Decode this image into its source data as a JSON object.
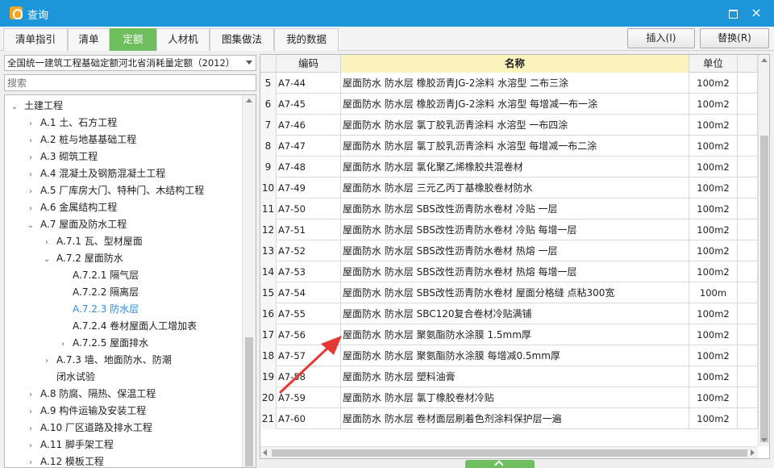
{
  "window": {
    "title": "查询",
    "maximize_glyph": "",
    "close_glyph": "×"
  },
  "tabs": [
    {
      "label": "清单指引",
      "active": false
    },
    {
      "label": "清单",
      "active": false
    },
    {
      "label": "定额",
      "active": true
    },
    {
      "label": "人材机",
      "active": false
    },
    {
      "label": "图集做法",
      "active": false
    },
    {
      "label": "我的数据",
      "active": false
    }
  ],
  "actions": {
    "insert": "插入(I)",
    "replace": "替换(R)"
  },
  "left": {
    "quota_library": "全国统一建筑工程基础定额河北省消耗量定额（2012）",
    "search_placeholder": "搜索",
    "tree": [
      {
        "label": "土建工程",
        "level": 0,
        "state": "open"
      },
      {
        "label": "A.1 土、石方工程",
        "level": 1,
        "state": "closed"
      },
      {
        "label": "A.2 桩与地基基础工程",
        "level": 1,
        "state": "closed"
      },
      {
        "label": "A.3 砌筑工程",
        "level": 1,
        "state": "closed"
      },
      {
        "label": "A.4 混凝土及钢筋混凝土工程",
        "level": 1,
        "state": "closed"
      },
      {
        "label": "A.5 厂库房大门、特种门、木结构工程",
        "level": 1,
        "state": "closed"
      },
      {
        "label": "A.6 金属结构工程",
        "level": 1,
        "state": "closed"
      },
      {
        "label": "A.7 屋面及防水工程",
        "level": 1,
        "state": "open"
      },
      {
        "label": "A.7.1 瓦、型材屋面",
        "level": 2,
        "state": "closed"
      },
      {
        "label": "A.7.2 屋面防水",
        "level": 2,
        "state": "open"
      },
      {
        "label": "A.7.2.1 隔气层",
        "level": 3,
        "state": "leaf"
      },
      {
        "label": "A.7.2.2 隔离层",
        "level": 3,
        "state": "leaf"
      },
      {
        "label": "A.7.2.3 防水层",
        "level": 3,
        "state": "leaf",
        "selected": true
      },
      {
        "label": "A.7.2.4 卷材屋面人工增加表",
        "level": 3,
        "state": "leaf"
      },
      {
        "label": "A.7.2.5 屋面排水",
        "level": 3,
        "state": "closed"
      },
      {
        "label": "A.7.3 墙、地面防水、防潮",
        "level": 2,
        "state": "closed"
      },
      {
        "label": "闭水试验",
        "level": 2,
        "state": "leaf"
      },
      {
        "label": "A.8 防腐、隔热、保温工程",
        "level": 1,
        "state": "closed"
      },
      {
        "label": "A.9 构件运输及安装工程",
        "level": 1,
        "state": "closed"
      },
      {
        "label": "A.10 厂区道路及排水工程",
        "level": 1,
        "state": "closed"
      },
      {
        "label": "A.11 脚手架工程",
        "level": 1,
        "state": "closed"
      },
      {
        "label": "A.12 模板工程",
        "level": 1,
        "state": "closed"
      }
    ]
  },
  "grid": {
    "columns": {
      "code": "编码",
      "name": "名称",
      "unit": "单位"
    },
    "rows": [
      {
        "no": "5",
        "code": "A7-44",
        "name": "屋面防水 防水层 橡胶沥青JG-2涂料 水溶型 二布三涂",
        "unit": "100m2"
      },
      {
        "no": "6",
        "code": "A7-45",
        "name": "屋面防水 防水层 橡胶沥青JG-2涂料 水溶型 每增减一布一涂",
        "unit": "100m2"
      },
      {
        "no": "7",
        "code": "A7-46",
        "name": "屋面防水 防水层 氯丁胶乳沥青涂料 水溶型 一布四涂",
        "unit": "100m2"
      },
      {
        "no": "8",
        "code": "A7-47",
        "name": "屋面防水 防水层 氯丁胶乳沥青涂料 水溶型 每增减一布二涂",
        "unit": "100m2"
      },
      {
        "no": "9",
        "code": "A7-48",
        "name": "屋面防水 防水层 氯化聚乙烯橡胶共混卷材",
        "unit": "100m2"
      },
      {
        "no": "10",
        "code": "A7-49",
        "name": "屋面防水 防水层 三元乙丙丁基橡胶卷材防水",
        "unit": "100m2"
      },
      {
        "no": "11",
        "code": "A7-50",
        "name": "屋面防水 防水层 SBS改性沥青防水卷材 冷贴 一层",
        "unit": "100m2"
      },
      {
        "no": "12",
        "code": "A7-51",
        "name": "屋面防水 防水层 SBS改性沥青防水卷材 冷贴 每增一层",
        "unit": "100m2"
      },
      {
        "no": "13",
        "code": "A7-52",
        "name": "屋面防水 防水层 SBS改性沥青防水卷材 热熔 一层",
        "unit": "100m2"
      },
      {
        "no": "14",
        "code": "A7-53",
        "name": "屋面防水 防水层 SBS改性沥青防水卷材 热熔 每增一层",
        "unit": "100m2"
      },
      {
        "no": "15",
        "code": "A7-54",
        "name": "屋面防水 防水层 SBS改性沥青防水卷材 屋面分格缝 点粘300宽",
        "unit": "100m"
      },
      {
        "no": "16",
        "code": "A7-55",
        "name": "屋面防水 防水层 SBC120复合卷材冷贴满铺",
        "unit": "100m2"
      },
      {
        "no": "17",
        "code": "A7-56",
        "name": "屋面防水 防水层 聚氨酯防水涂膜 1.5mm厚",
        "unit": "100m2"
      },
      {
        "no": "18",
        "code": "A7-57",
        "name": "屋面防水 防水层 聚氨酯防水涂膜 每增减0.5mm厚",
        "unit": "100m2"
      },
      {
        "no": "19",
        "code": "A7-58",
        "name": "屋面防水 防水层 塑料油膏",
        "unit": "100m2"
      },
      {
        "no": "20",
        "code": "A7-59",
        "name": "屋面防水 防水层 氯丁橡胶卷材冷贴",
        "unit": "100m2"
      },
      {
        "no": "21",
        "code": "A7-60",
        "name": "屋面防水 防水层 卷材面层刷着色剂涂料保护层一遍",
        "unit": "100m2"
      }
    ]
  },
  "colors": {
    "titlebar": "#1c96d8",
    "active_tab": "#6fbf5e",
    "name_header": "#fbf4bf",
    "selected_node": "#2b8ee0",
    "arrow": "#e53935"
  }
}
